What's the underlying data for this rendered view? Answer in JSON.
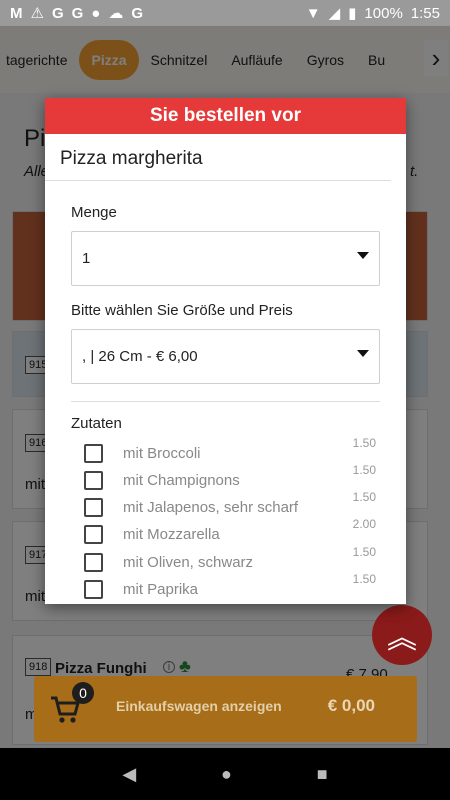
{
  "status_bar": {
    "left_glyphs": [
      "M",
      "⚠",
      "G",
      "G",
      "●",
      "☁",
      "G"
    ],
    "battery": "100%",
    "time": "1:55"
  },
  "categories": [
    "tagerichte",
    "Pizza",
    "Schnitzel",
    "Aufläufe",
    "Gyros",
    "Bu"
  ],
  "active_category": "Pizza",
  "background": {
    "heading": "Pi",
    "subheading": "Alle",
    "subheading_end": "t.",
    "items": [
      {
        "num": "915"
      },
      {
        "num": "916",
        "text": "mit"
      },
      {
        "num": "917",
        "text": "mit"
      },
      {
        "num": "918",
        "name": "Pizza Funghi",
        "price": "€ 7,90",
        "text": "mit"
      }
    ]
  },
  "modal": {
    "header": "Sie bestellen vor",
    "product": "Pizza margherita",
    "quantity_label": "Menge",
    "quantity_value": "1",
    "size_label": "Bitte wählen Sie Größe und Preis",
    "size_value": ", | 26 Cm - € 6,00",
    "ingredients_label": "Zutaten",
    "ingredients": [
      {
        "name": "mit Broccoli",
        "price": "1.50"
      },
      {
        "name": "mit Champignons",
        "price": "1.50"
      },
      {
        "name": "mit Jalapenos, sehr scharf",
        "price": "1.50"
      },
      {
        "name": "mit Mozzarella",
        "price": "2.00"
      },
      {
        "name": "mit Oliven, schwarz",
        "price": "1.50"
      },
      {
        "name": "mit Paprika",
        "price": "1.50"
      }
    ]
  },
  "cart": {
    "count": "0",
    "label": "Einkaufswagen anzeigen",
    "total": "€ 0,00"
  },
  "colors": {
    "accent": "#f7a233",
    "modal_header": "#e63a3a",
    "cart": "#a86d18"
  }
}
